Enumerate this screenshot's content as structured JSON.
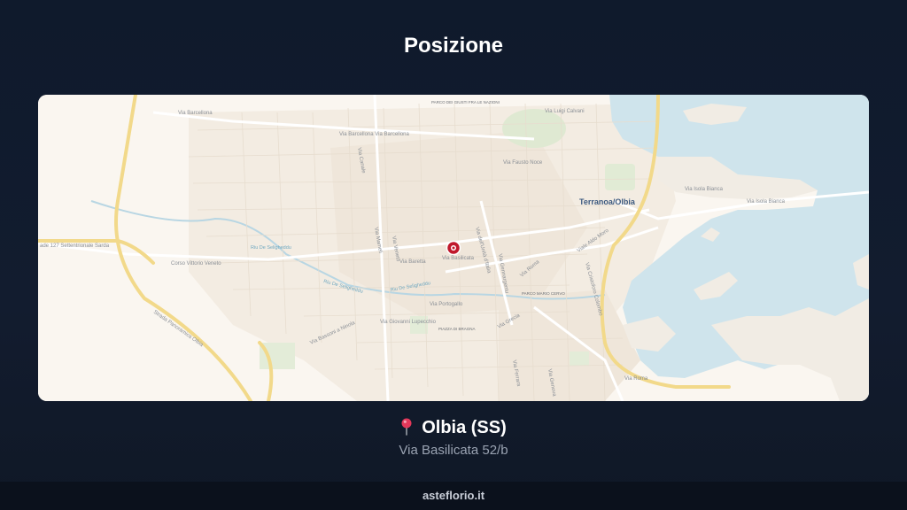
{
  "page": {
    "title": "Posizione"
  },
  "map": {
    "city_label": "Terranoa/Olbia",
    "streets": {
      "s1": "Via Barcellona",
      "s2": "Via Barcellona Via Barcellona",
      "s3": "Via Luigi Calvani",
      "s4": "Via Fausto Noce",
      "s5": "Via Isola Bianca",
      "s6": "Via Isola Bianca",
      "s7": "ade 127 Settentrionale Sarda",
      "s8": "Corso Vittorio Veneto",
      "s9": "Strada Panoramica Olbia",
      "s10": "Via Baretta",
      "s11": "Via Basilicata",
      "s12": "Via dell'Unità d'Italia",
      "s13": "Via Roma",
      "s14": "Via Portogallo",
      "s15": "Via Roma",
      "s16": "Via Bassoni a Ninola",
      "s17": "Via Giovanni Lupecchio",
      "s18": "Via Canale",
      "s19": "Viale Aldo Moro",
      "s20": "Via Gennargentu",
      "s21": "Via Mameli",
      "s22": "Via Grecia",
      "s23": "Via Veneto",
      "s24": "Via Ferrara",
      "s25": "Via Genova",
      "s26": "Via Cristoforo Colombo"
    },
    "waters": {
      "w1": "Riu De Seligheddu",
      "w2": "Riu De Seligheddu",
      "w3": "Riu De Seligheddu"
    },
    "places": {
      "p1": "PARCO DEI GIUSTI FRA LE NAZIONI",
      "p2": "PARCO MARIO CERVO",
      "p3": "PIAZZA DI BRAGNA"
    },
    "marker": {
      "name": "location-marker",
      "color": "#c0182c"
    }
  },
  "location": {
    "city": "Olbia (SS)",
    "address": "Via Basilicata 52/b",
    "pin_icon": "round-pushpin"
  },
  "footer": {
    "site": "asteflorio.it"
  }
}
